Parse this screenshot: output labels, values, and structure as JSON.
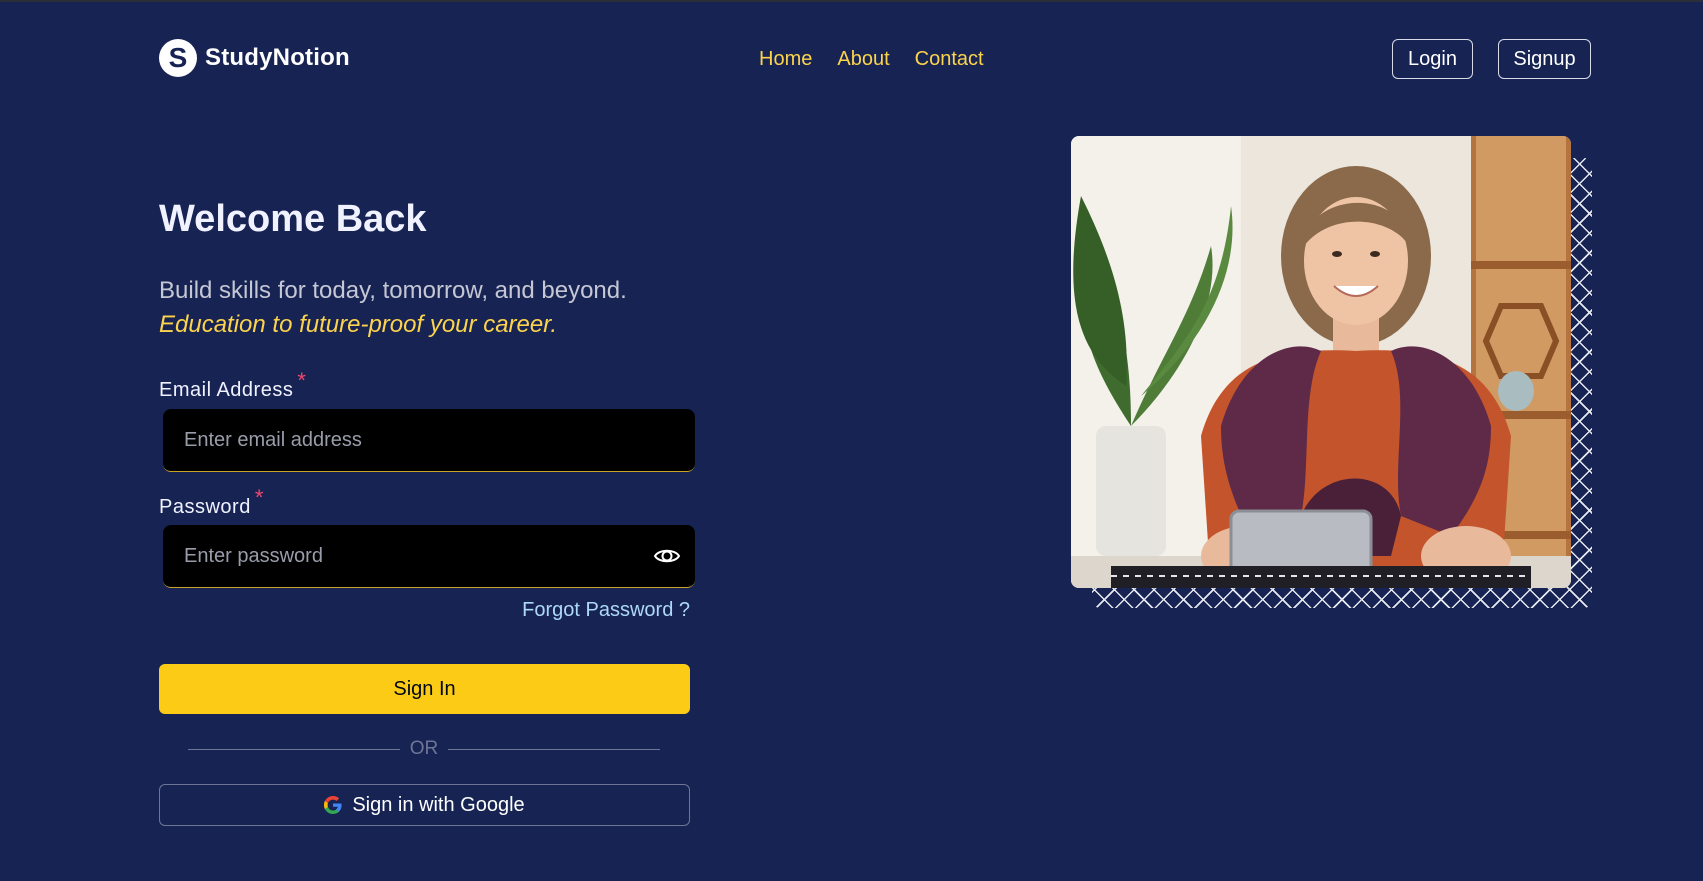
{
  "brand": {
    "logo_letter": "S",
    "name": "StudyNotion"
  },
  "nav": {
    "links": [
      "Home",
      "About",
      "Contact"
    ],
    "link_color": "#fcd34d"
  },
  "auth_buttons": {
    "login": "Login",
    "signup": "Signup"
  },
  "form": {
    "title": "Welcome Back",
    "subtitle": "Build skills for today, tomorrow, and beyond.",
    "subtitle_accent": "Education to future-proof your career.",
    "email": {
      "label": "Email Address",
      "required_mark": "*",
      "placeholder": "Enter email address"
    },
    "password": {
      "label": "Password",
      "required_mark": "*",
      "placeholder": "Enter password"
    },
    "forgot_password": "Forgot Password ?",
    "sign_in_label": "Sign In",
    "divider_text": "OR",
    "google_label": "Sign in with Google"
  },
  "icons": {
    "eye": "eye-icon",
    "google": "google-icon"
  },
  "colors": {
    "background": "#172453",
    "accent_yellow": "#fbcb16",
    "required_red": "#ef476f",
    "link_blue": "#add8f7"
  }
}
